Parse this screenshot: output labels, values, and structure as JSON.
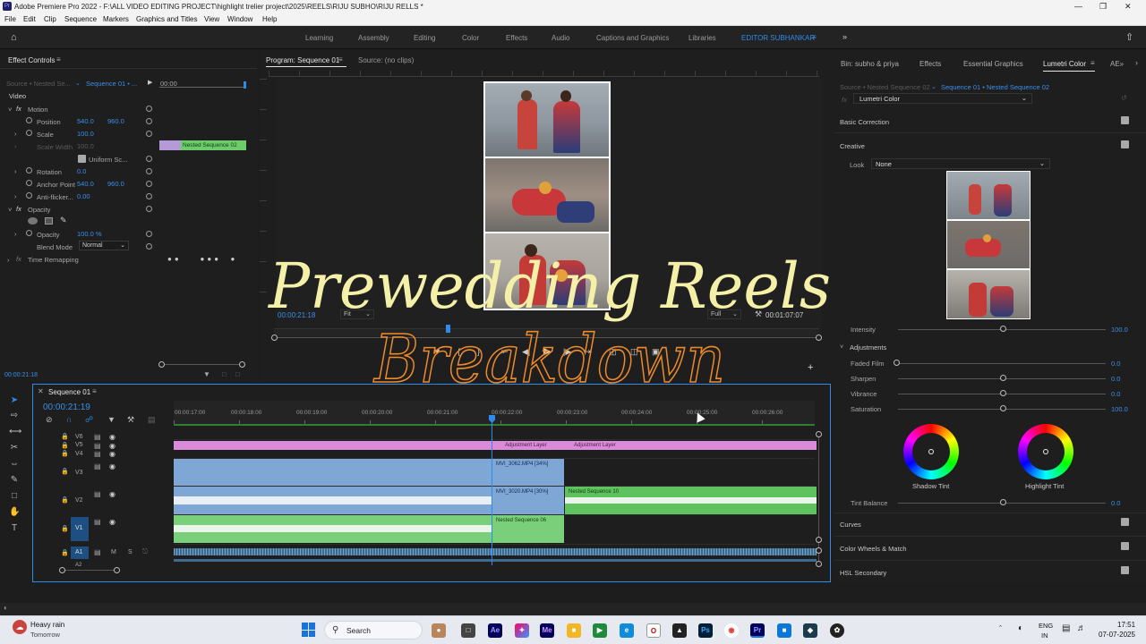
{
  "window": {
    "title": "Adobe Premiere Pro 2022 - F:\\ALL VIDEO EDITING PROJECT\\highlight trelier project\\2025\\REELS\\RIJU SUBHO\\RIJU RELLS *",
    "app_badge": "Pr"
  },
  "menu": [
    "File",
    "Edit",
    "Clip",
    "Sequence",
    "Markers",
    "Graphics and Titles",
    "View",
    "Window",
    "Help"
  ],
  "workspaces": [
    "Learning",
    "Assembly",
    "Editing",
    "Color",
    "Effects",
    "Audio",
    "Captions and Graphics",
    "Libraries",
    "EDITOR SUBHANKAR"
  ],
  "effect_controls": {
    "tab": "Effect Controls",
    "source": "Source • Nested Se...",
    "sequence": "Sequence 01 • ...",
    "mini_time": "00:00",
    "mini_clip": "Nested Sequence 02",
    "video_header": "Video",
    "motion": "Motion",
    "position_label": "Position",
    "position_x": "540.0",
    "position_y": "960.0",
    "scale_label": "Scale",
    "scale_val": "100.0",
    "scale_width_label": "Scale Width",
    "scale_width_val": "100.0",
    "uniform_scale": "Uniform Sc...",
    "rotation_label": "Rotation",
    "rotation_val": "0.0",
    "anchor_label": "Anchor Point",
    "anchor_x": "540.0",
    "anchor_y": "960.0",
    "antiflicker_label": "Anti-flicker...",
    "antiflicker_val": "0.00",
    "opacity_group": "Opacity",
    "opacity_label": "Opacity",
    "opacity_val": "100.0 %",
    "blend_label": "Blend Mode",
    "blend_val": "Normal",
    "time_remap": "Time Remapping",
    "current_time": "00:00:21:18"
  },
  "program_monitor": {
    "tab": "Program: Sequence 01",
    "source_tab": "Source: (no clips)",
    "timecode": "00:00:21:18",
    "fit": "Fit",
    "quality": "Full",
    "duration": "00:01:07:07"
  },
  "overlay_text": {
    "line1": "Prewedding Reels",
    "line2": "Breakdown"
  },
  "timeline": {
    "tab": "Sequence 01",
    "timecode": "00:00:21:19",
    "ruler": [
      "00:00:17:00",
      "00:00:18:00",
      "00:00:19:00",
      "00:00:20:00",
      "00:00:21:00",
      "00:00:22:00",
      "00:00:23:00",
      "00:00:24:00",
      "00:00:25:00",
      "00:00:26:00"
    ],
    "tracks": [
      "V6",
      "V5",
      "V4",
      "V3",
      "V2",
      "V1",
      "A1",
      "A2"
    ],
    "clips": {
      "adj1": "Adjustment Layer",
      "adj2": "Adjustment Layer",
      "v3": "MVI_3062.MP4 [34%]",
      "v2a": "MVI_3020.MP4 [30%]",
      "v2b": "Nested Sequence 10",
      "v1": "Nested Sequence 06"
    },
    "track_letters": {
      "m": "M",
      "s": "S"
    }
  },
  "right_panel": {
    "tabs": [
      "Bin: subho & priya",
      "Effects",
      "Essential Graphics",
      "Lumetri Color",
      "AE»"
    ],
    "source": "Source • Nested Sequence 02",
    "sequence": "Sequence 01 • Nested Sequence 02",
    "effect": "Lumetri Color",
    "fx_label": "fx",
    "basic_correction": "Basic Correction",
    "creative": "Creative",
    "look_label": "Look",
    "look_val": "None",
    "intensity_label": "Intensity",
    "intensity_val": "100.0",
    "adjustments": "Adjustments",
    "faded_film": "Faded Film",
    "faded_film_val": "0.0",
    "sharpen": "Sharpen",
    "sharpen_val": "0.0",
    "vibrance": "Vibrance",
    "vibrance_val": "0.0",
    "saturation": "Saturation",
    "saturation_val": "100.0",
    "shadow_tint": "Shadow Tint",
    "highlight_tint": "Highlight Tint",
    "tint_balance": "Tint Balance",
    "tint_balance_val": "0.0",
    "curves": "Curves",
    "color_wheels": "Color Wheels & Match",
    "hsl": "HSL Secondary"
  },
  "taskbar": {
    "weather_title": "Heavy rain",
    "weather_sub": "Tomorrow",
    "search": "Search",
    "lang1": "ENG",
    "lang2": "IN",
    "time": "17:51",
    "date": "07-07-2025"
  },
  "colors": {
    "accent": "#2d8ceb",
    "adjustment_clip": "#d98ad8",
    "video_clip_blue": "#7fa7d6",
    "video_clip_green": "#7ad07a",
    "title_yellow": "#f5f0a8",
    "title_orange": "#ee8a2a"
  }
}
